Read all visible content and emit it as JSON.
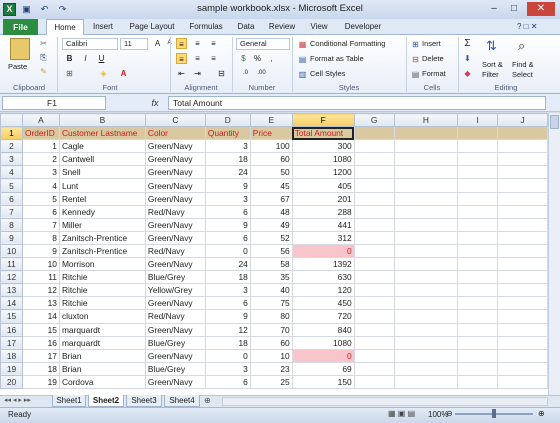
{
  "window": {
    "title": "sample workbook.xlsx - Microsoft Excel",
    "app_icon": "X"
  },
  "qat": [
    "save-icon",
    "undo-icon",
    "redo-icon"
  ],
  "tabs": [
    "File",
    "Home",
    "Insert",
    "Page Layout",
    "Formulas",
    "Data",
    "Review",
    "View",
    "Developer"
  ],
  "ribbon": {
    "clipboard": {
      "paste": "Paste",
      "label": "Clipboard"
    },
    "font": {
      "name": "Calibri",
      "size": "11",
      "bold": "B",
      "italic": "I",
      "underline": "U",
      "grow": "A",
      "shrink": "A",
      "label": "Font"
    },
    "alignment": {
      "label": "Alignment"
    },
    "number": {
      "format": "General",
      "currency": "$",
      "percent": "%",
      "comma": ",",
      "label": "Number"
    },
    "styles": {
      "cond": "Conditional Formatting",
      "table": "Format as Table",
      "cell": "Cell Styles",
      "label": "Styles"
    },
    "cells": {
      "insert": "Insert",
      "delete": "Delete",
      "format": "Format",
      "label": "Cells"
    },
    "editing": {
      "sum": "Σ",
      "sort": "Sort &",
      "sort2": "Filter",
      "find": "Find &",
      "find2": "Select",
      "label": "Editing"
    }
  },
  "formula": {
    "cell": "F1",
    "fx": "fx",
    "content": "Total Amount"
  },
  "columns": [
    "A",
    "B",
    "C",
    "D",
    "E",
    "F",
    "G",
    "H",
    "I",
    "J"
  ],
  "selected_col": "F",
  "selected_row": "1",
  "rows": [
    {
      "n": "1",
      "hdr": true,
      "cells": [
        "OrderID",
        "Customer Lastname",
        "Color",
        "Quantity",
        "Price",
        "Total Amount"
      ]
    },
    {
      "n": "2",
      "cells": [
        "1",
        "Cagle",
        "Green/Navy",
        "3",
        "100",
        "300"
      ]
    },
    {
      "n": "3",
      "cells": [
        "2",
        "Cantwell",
        "Green/Navy",
        "18",
        "60",
        "1080"
      ]
    },
    {
      "n": "4",
      "cells": [
        "3",
        "Snell",
        "Green/Navy",
        "24",
        "50",
        "1200"
      ]
    },
    {
      "n": "5",
      "cells": [
        "4",
        "Lunt",
        "Green/Navy",
        "9",
        "45",
        "405"
      ]
    },
    {
      "n": "6",
      "cells": [
        "5",
        "Rentel",
        "Green/Navy",
        "3",
        "67",
        "201"
      ]
    },
    {
      "n": "7",
      "cells": [
        "6",
        "Kennedy",
        "Red/Navy",
        "6",
        "48",
        "288"
      ]
    },
    {
      "n": "8",
      "cells": [
        "7",
        "Miller",
        "Green/Navy",
        "9",
        "49",
        "441"
      ]
    },
    {
      "n": "9",
      "cells": [
        "8",
        "Zanitsch-Prentice",
        "Green/Navy",
        "6",
        "52",
        "312"
      ]
    },
    {
      "n": "10",
      "cells": [
        "9",
        "Zanitsch-Prentice",
        "Red/Navy",
        "0",
        "56",
        "0"
      ],
      "pink": true
    },
    {
      "n": "11",
      "cells": [
        "10",
        "Morrison",
        "Green/Navy",
        "24",
        "58",
        "1392"
      ]
    },
    {
      "n": "12",
      "cells": [
        "11",
        "Ritchie",
        "Blue/Grey",
        "18",
        "35",
        "630"
      ]
    },
    {
      "n": "13",
      "cells": [
        "12",
        "Ritchie",
        "Yellow/Grey",
        "3",
        "40",
        "120"
      ]
    },
    {
      "n": "14",
      "cells": [
        "13",
        "Ritchie",
        "Green/Navy",
        "6",
        "75",
        "450"
      ]
    },
    {
      "n": "15",
      "cells": [
        "14",
        "cluxton",
        "Red/Navy",
        "9",
        "80",
        "720"
      ]
    },
    {
      "n": "16",
      "cells": [
        "15",
        "marquardt",
        "Green/Navy",
        "12",
        "70",
        "840"
      ]
    },
    {
      "n": "17",
      "cells": [
        "16",
        "marquardt",
        "Blue/Grey",
        "18",
        "60",
        "1080"
      ]
    },
    {
      "n": "18",
      "cells": [
        "17",
        "Brian",
        "Green/Navy",
        "0",
        "10",
        "0"
      ],
      "pink": true
    },
    {
      "n": "19",
      "cells": [
        "18",
        "Brian",
        "Blue/Grey",
        "3",
        "23",
        "69"
      ]
    },
    {
      "n": "20",
      "cells": [
        "19",
        "Cordova",
        "Green/Navy",
        "6",
        "25",
        "150"
      ]
    }
  ],
  "sheets": [
    "Sheet1",
    "Sheet2",
    "Sheet3",
    "Sheet4"
  ],
  "active_sheet": "Sheet2",
  "status": {
    "ready": "Ready",
    "zoom": "100%"
  }
}
